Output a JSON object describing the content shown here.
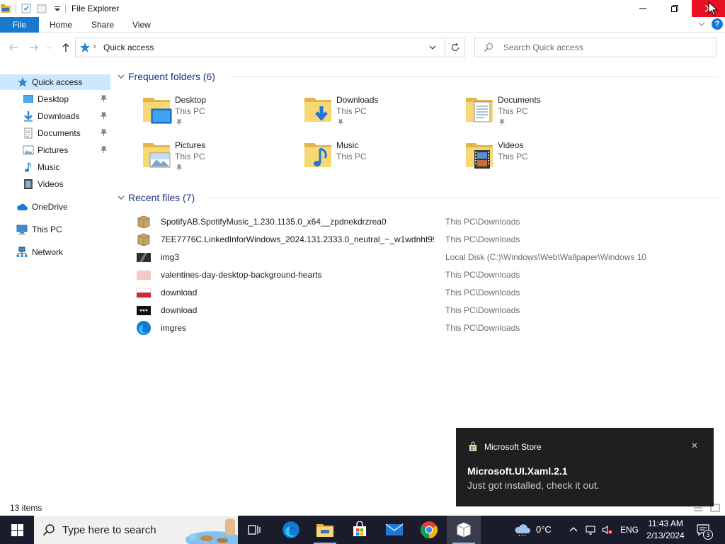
{
  "window": {
    "title": "File Explorer",
    "quick_access_toolbar": [
      "folder-icon",
      "properties-icon",
      "new-folder-icon",
      "customize-dropdown-icon"
    ]
  },
  "ribbon": {
    "tabs": [
      {
        "label": "File",
        "active": true
      },
      {
        "label": "Home"
      },
      {
        "label": "Share"
      },
      {
        "label": "View"
      }
    ],
    "help": "?"
  },
  "address_bar": {
    "location": "Quick access",
    "search_placeholder": "Search Quick access"
  },
  "navigation_pane": {
    "items": [
      {
        "label": "Quick access",
        "icon": "star-icon",
        "selected": true
      },
      {
        "label": "Desktop",
        "icon": "desktop-icon",
        "pinned": true
      },
      {
        "label": "Downloads",
        "icon": "download-icon",
        "pinned": true
      },
      {
        "label": "Documents",
        "icon": "documents-icon",
        "pinned": true
      },
      {
        "label": "Pictures",
        "icon": "pictures-icon",
        "pinned": true
      },
      {
        "label": "Music",
        "icon": "music-icon"
      },
      {
        "label": "Videos",
        "icon": "videos-icon"
      },
      {
        "label": "OneDrive",
        "icon": "cloud-icon"
      },
      {
        "label": "This PC",
        "icon": "computer-icon"
      },
      {
        "label": "Network",
        "icon": "network-icon"
      }
    ]
  },
  "frequent_folders": {
    "header": "Frequent folders (6)",
    "items": [
      {
        "name": "Desktop",
        "location": "This PC",
        "pinned": true,
        "icon": "desktop-folder-icon"
      },
      {
        "name": "Downloads",
        "location": "This PC",
        "pinned": true,
        "icon": "downloads-folder-icon"
      },
      {
        "name": "Documents",
        "location": "This PC",
        "pinned": true,
        "icon": "documents-folder-icon"
      },
      {
        "name": "Pictures",
        "location": "This PC",
        "pinned": true,
        "icon": "pictures-folder-icon"
      },
      {
        "name": "Music",
        "location": "This PC",
        "pinned": false,
        "icon": "music-folder-icon"
      },
      {
        "name": "Videos",
        "location": "This PC",
        "pinned": false,
        "icon": "videos-folder-icon"
      }
    ]
  },
  "recent_files": {
    "header": "Recent files (7)",
    "items": [
      {
        "name": "SpotifyAB.SpotifyMusic_1.230.1135.0_x64__zpdnekdrzrea0",
        "path": "This PC\\Downloads",
        "icon": "package-icon"
      },
      {
        "name": "7EE7776C.LinkedInforWindows_2024.131.2333.0_neutral_~_w1wdnht996...",
        "path": "This PC\\Downloads",
        "icon": "package-icon"
      },
      {
        "name": "img3",
        "path": "Local Disk (C:)\\Windows\\Web\\Wallpaper\\Windows 10",
        "icon": "image-dark-icon"
      },
      {
        "name": "valentines-day-desktop-background-hearts",
        "path": "This PC\\Downloads",
        "icon": "image-pink-icon"
      },
      {
        "name": "download",
        "path": "This PC\\Downloads",
        "icon": "image-red-icon"
      },
      {
        "name": "download",
        "path": "This PC\\Downloads",
        "icon": "image-black-icon"
      },
      {
        "name": "imgres",
        "path": "This PC\\Downloads",
        "icon": "edge-icon"
      }
    ]
  },
  "status_bar": {
    "item_count": "13 items"
  },
  "toast": {
    "app": "Microsoft Store",
    "title": "Microsoft.UI.Xaml.2.1",
    "body": "Just got installed, check it out.",
    "close": "×"
  },
  "taskbar": {
    "search_placeholder": "Type here to search",
    "apps": [
      "task-view-icon",
      "edge-icon",
      "file-explorer-icon",
      "microsoft-store-icon",
      "mail-icon",
      "chrome-icon",
      "package-icon"
    ],
    "temperature": "0°C",
    "language": "ENG",
    "time": "11:43 AM",
    "date": "2/13/2024",
    "notification_count": "3"
  },
  "colors": {
    "accent": "#1979ca",
    "close_red": "#e81123",
    "selected_bg": "#cce8ff",
    "group_header": "#1e3287",
    "toast_bg": "#1f1f1f",
    "taskbar_bg": "#1a1c2c"
  }
}
